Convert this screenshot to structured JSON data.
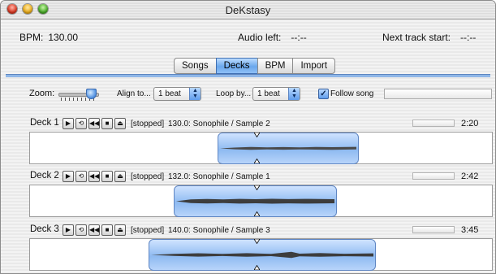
{
  "window": {
    "title": "DeKstasy"
  },
  "info": {
    "bpm_label": "BPM:",
    "bpm_value": "130.00",
    "audio_left_label": "Audio left:",
    "audio_left_value": "--:--",
    "next_track_label": "Next track start:",
    "next_track_value": "--:--"
  },
  "tabs": [
    {
      "label": "Songs",
      "active": false
    },
    {
      "label": "Decks",
      "active": true
    },
    {
      "label": "BPM",
      "active": false
    },
    {
      "label": "Import",
      "active": false
    }
  ],
  "toolbar": {
    "zoom_label": "Zoom:",
    "zoom_level": 0.85,
    "align_label": "Align to...",
    "align_value": "1 beat",
    "loop_label": "Loop by...",
    "loop_value": "1 beat",
    "follow_label": "Follow song",
    "follow_checked": true
  },
  "decks": [
    {
      "name": "Deck 1",
      "status": "[stopped]",
      "track": "130.0: Sonophile / Sample 2",
      "time": "2:20"
    },
    {
      "name": "Deck 2",
      "status": "[stopped]",
      "track": "132.0: Sonophile / Sample 1",
      "time": "2:42"
    },
    {
      "name": "Deck 3",
      "status": "[stopped]",
      "track": "140.0: Sonophile / Sample 3",
      "time": "3:45"
    }
  ],
  "icons": {
    "play": "play-icon",
    "loop": "loop-icon",
    "rewind": "rewind-icon",
    "stop": "stop-icon",
    "eject": "eject-icon"
  }
}
